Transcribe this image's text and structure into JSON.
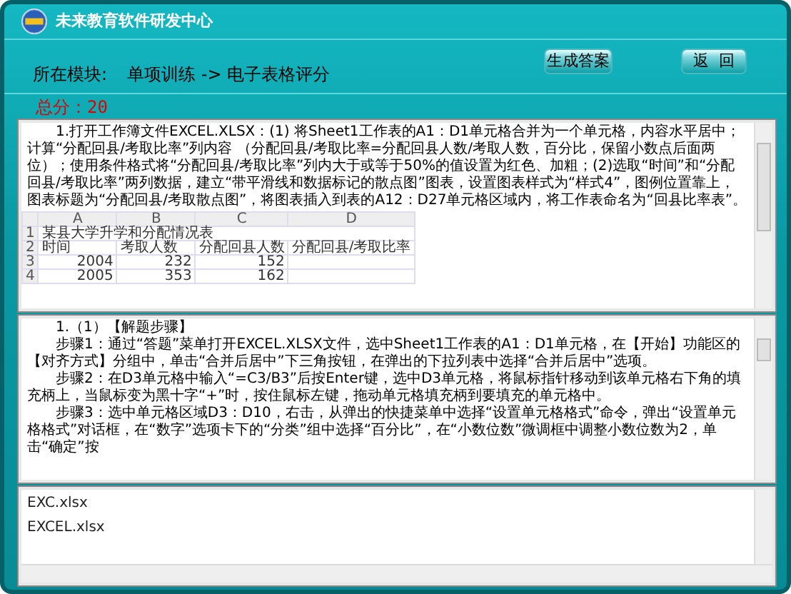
{
  "window": {
    "title": "未来教育软件研发中心"
  },
  "module": {
    "label": "所在模块:",
    "path": "单项训练 -> 电子表格评分"
  },
  "buttons": [
    {
      "label": "生成答案"
    },
    {
      "label": "返  回"
    }
  ],
  "score": {
    "text": "总分：20"
  },
  "question": {
    "text": "1.打开工作簿文件EXCEL.XLSX：(1) 将Sheet1工作表的A1：D1单元格合并为一个单元格，内容水平居中；计算“分配回县/考取比率”列内容 （分配回县/考取比率=分配回县人数/考取人数，百分比，保留小数点后面两位）；使用条件格式将“分配回县/考取比率”列内大于或等于50%的值设置为红色、加粗；(2)选取“时间”和“分配回县/考取比率”两列数据，建立“带平滑线和数据标记的散点图”图表，设置图表样式为“样式4”，图例位置靠上，图表标题为“分配回县/考取散点图”，将图表插入到表的A12：D27单元格区域内，将工作表命名为“回县比率表”。",
    "sheet": {
      "columns": [
        "A",
        "B",
        "C",
        "D"
      ],
      "rows": [
        {
          "num": "1",
          "title": "某县大学升学和分配情况表"
        },
        {
          "num": "2",
          "cells": [
            "时间",
            "考取人数",
            "分配回县人数",
            "分配回县/考取比率"
          ]
        },
        {
          "num": "3",
          "cells": [
            "2004",
            "232",
            "152"
          ]
        },
        {
          "num": "4",
          "cells": [
            "2005",
            "353",
            "162"
          ]
        }
      ]
    }
  },
  "answer": {
    "paragraphs": [
      "1.（1）【解题步骤】",
      "步骤1：通过“答题”菜单打开EXCEL.XLSX文件，选中Sheet1工作表的A1：D1单元格，在【开始】功能区的【对齐方式】分组中，单击“合并后居中”下三角按钮，在弹出的下拉列表中选择“合并后居中”选项。",
      "步骤2：在D3单元格中输入“=C3/B3”后按Enter键，选中D3单元格，将鼠标指针移动到该单元格右下角的填充柄上，当鼠标变为黑十字“+”时，按住鼠标左键，拖动单元格填充柄到要填充的单元格中。",
      "步骤3：选中单元格区域D3：D10，右击，从弹出的快捷菜单中选择“设置单元格格式”命令，弹出“设置单元格格式”对话框，在“数字”选项卡下的“分类”组中选择“百分比”，在“小数位数”微调框中调整小数位数为2，单击“确定”按"
    ]
  },
  "files": [
    "EXC.xlsx",
    "EXCEL.xlsx"
  ]
}
